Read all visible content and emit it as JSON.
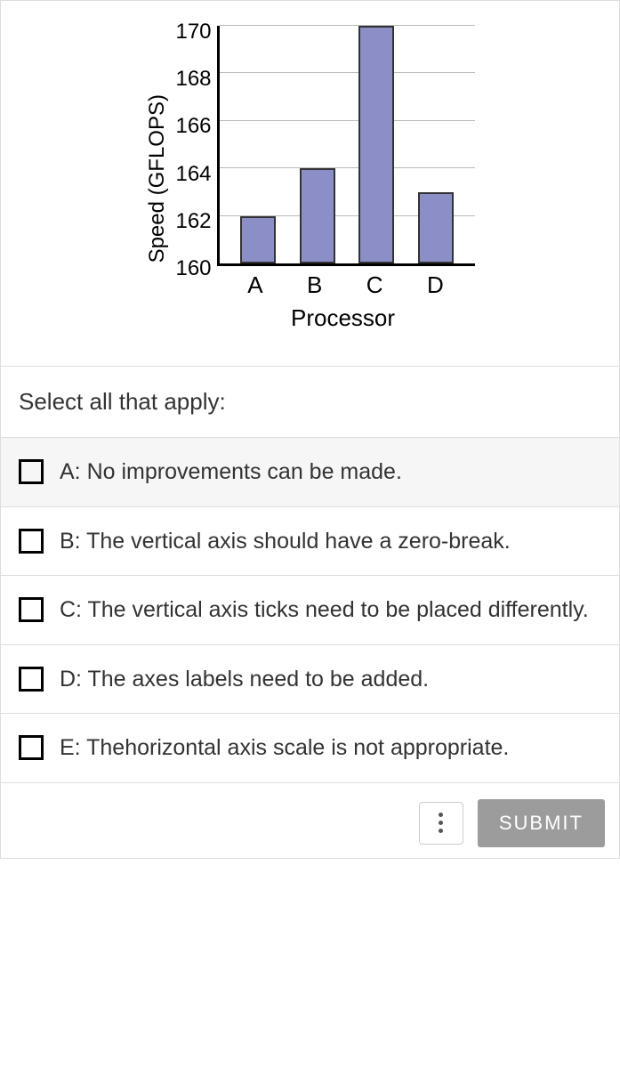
{
  "chart_data": {
    "type": "bar",
    "categories": [
      "A",
      "B",
      "C",
      "D"
    ],
    "values": [
      162,
      164,
      170,
      163
    ],
    "title": "",
    "xlabel": "Processor",
    "ylabel": "Speed (GFLOPS)",
    "yticks": [
      170,
      168,
      166,
      164,
      162,
      160
    ],
    "ylim": [
      160,
      170
    ]
  },
  "question": {
    "prompt": "Select all that apply:",
    "options": [
      {
        "label": "A: No improvements can be made."
      },
      {
        "label": "B: The vertical axis should have a zero-break."
      },
      {
        "label": "C: The vertical axis ticks need to be placed differently."
      },
      {
        "label": "D: The axes labels need to be added."
      },
      {
        "label": "E: Thehorizontal axis scale is not appropriate."
      }
    ]
  },
  "footer": {
    "submit": "SUBMIT"
  }
}
